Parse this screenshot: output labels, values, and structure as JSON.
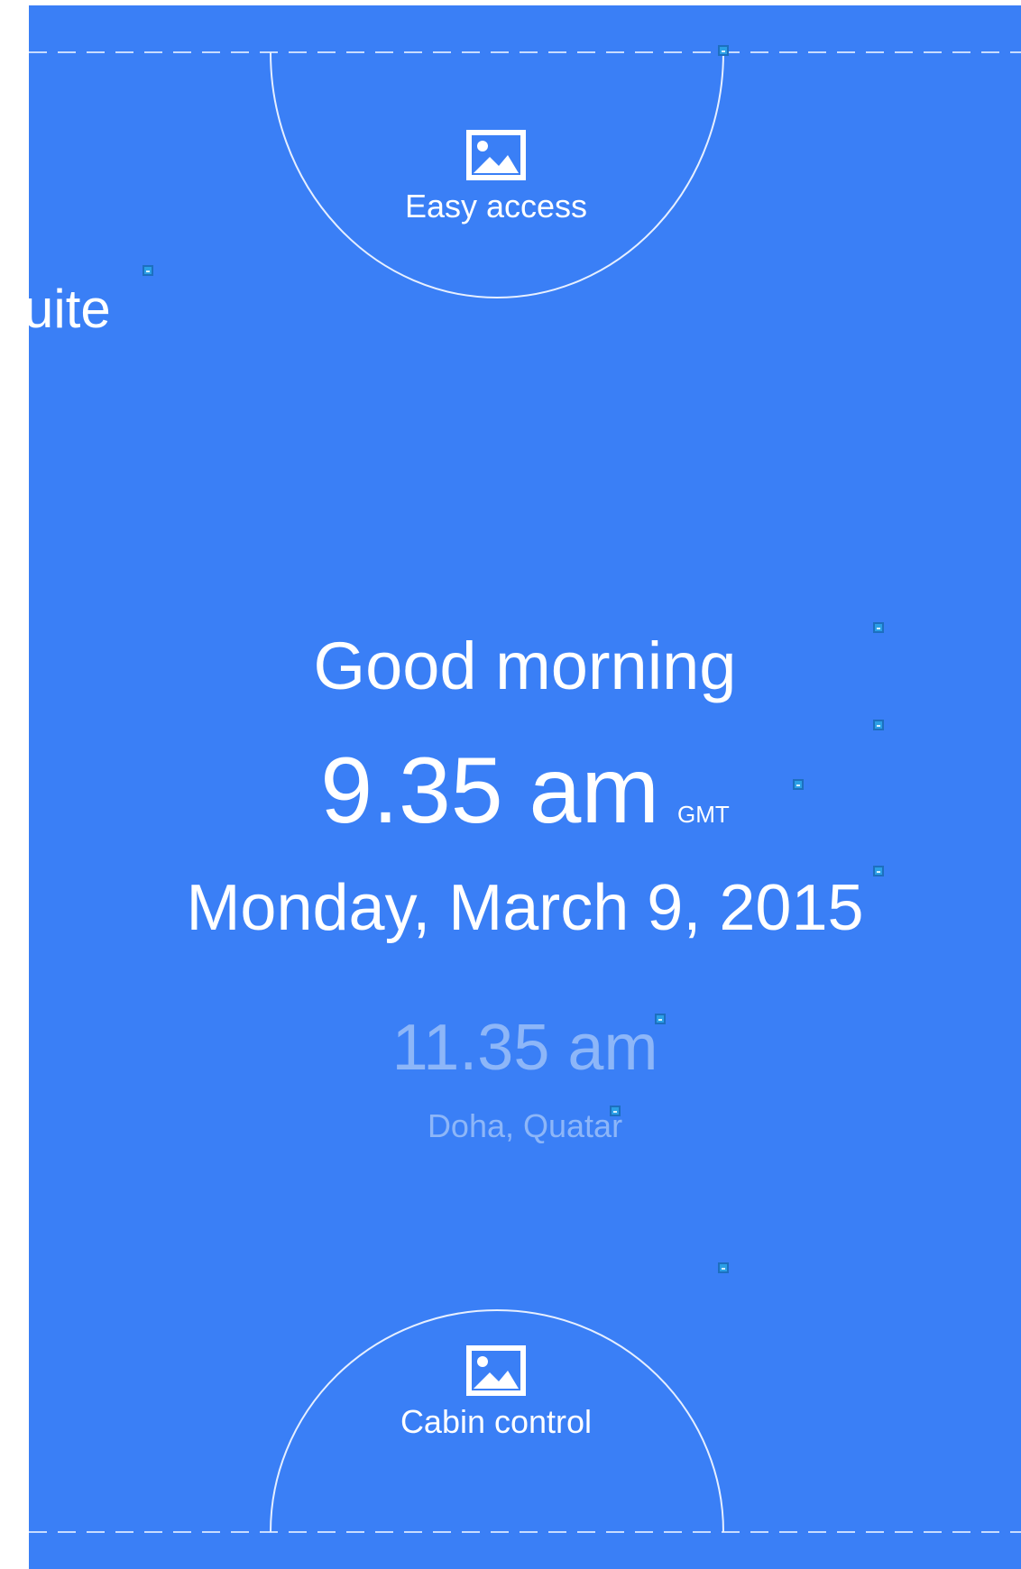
{
  "header": {
    "partial_title": "uite"
  },
  "top_action": {
    "label": "Easy access",
    "icon": "image-icon"
  },
  "bottom_action": {
    "label": "Cabin control",
    "icon": "image-icon"
  },
  "clock": {
    "greeting": "Good morning",
    "time": "9.35 am",
    "timezone": "GMT",
    "date": "Monday, March 9, 2015"
  },
  "secondary_clock": {
    "time": "11.35 am",
    "location": "Doha, Quatar"
  },
  "colors": {
    "background": "#3a7ff6",
    "text": "#ffffff",
    "muted_text": "#8db6f8",
    "marker": "#2b9fe6"
  }
}
